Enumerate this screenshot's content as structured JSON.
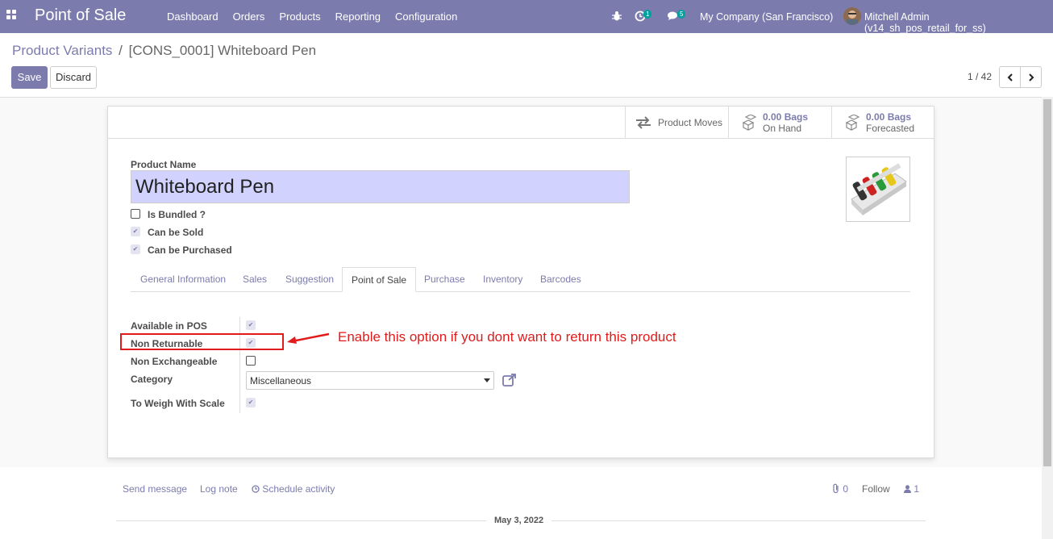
{
  "navbar": {
    "brand": "Point of Sale",
    "menu": [
      "Dashboard",
      "Orders",
      "Products",
      "Reporting",
      "Configuration"
    ],
    "activity_count": "1",
    "message_count": "5",
    "company": "My Company (San Francisco)",
    "user": "Mitchell Admin (v14_sh_pos_retail_for_ss)"
  },
  "control": {
    "breadcrumb_parent": "Product Variants",
    "breadcrumb_sep": "/",
    "breadcrumb_current": "[CONS_0001] Whiteboard Pen",
    "save_label": "Save",
    "discard_label": "Discard",
    "pager": "1 / 42"
  },
  "smart_buttons": {
    "moves_label": "Product Moves",
    "onhand_value": "0.00 Bags",
    "onhand_label": "On Hand",
    "forecast_value": "0.00 Bags",
    "forecast_label": "Forecasted"
  },
  "form": {
    "name_label": "Product Name",
    "name_value": "Whiteboard Pen",
    "is_bundled_label": "Is Bundled ?",
    "can_be_sold_label": "Can be Sold",
    "can_be_purchased_label": "Can be Purchased",
    "is_bundled": false,
    "can_be_sold": true,
    "can_be_purchased": true
  },
  "tabs": [
    "General Information",
    "Sales",
    "Suggestion",
    "Point of Sale",
    "Purchase",
    "Inventory",
    "Barcodes"
  ],
  "active_tab": "Point of Sale",
  "pos_fields": {
    "available_label": "Available in POS",
    "non_returnable_label": "Non Returnable",
    "non_exchangeable_label": "Non Exchangeable",
    "category_label": "Category",
    "category_value": "Miscellaneous",
    "weigh_label": "To Weigh With Scale",
    "available": true,
    "non_returnable": true,
    "non_exchangeable": false,
    "weigh": true
  },
  "annotation": {
    "text": "Enable this option if you dont want to return this product",
    "color": "#e11b1b"
  },
  "chatter": {
    "send_message": "Send message",
    "log_note": "Log note",
    "schedule_activity": "Schedule activity",
    "attachments": "0",
    "follow": "Follow",
    "followers": "1",
    "date": "May 3, 2022"
  },
  "colors": {
    "brand": "#7c7bad",
    "name_field_bg": "#d2d2ff"
  }
}
